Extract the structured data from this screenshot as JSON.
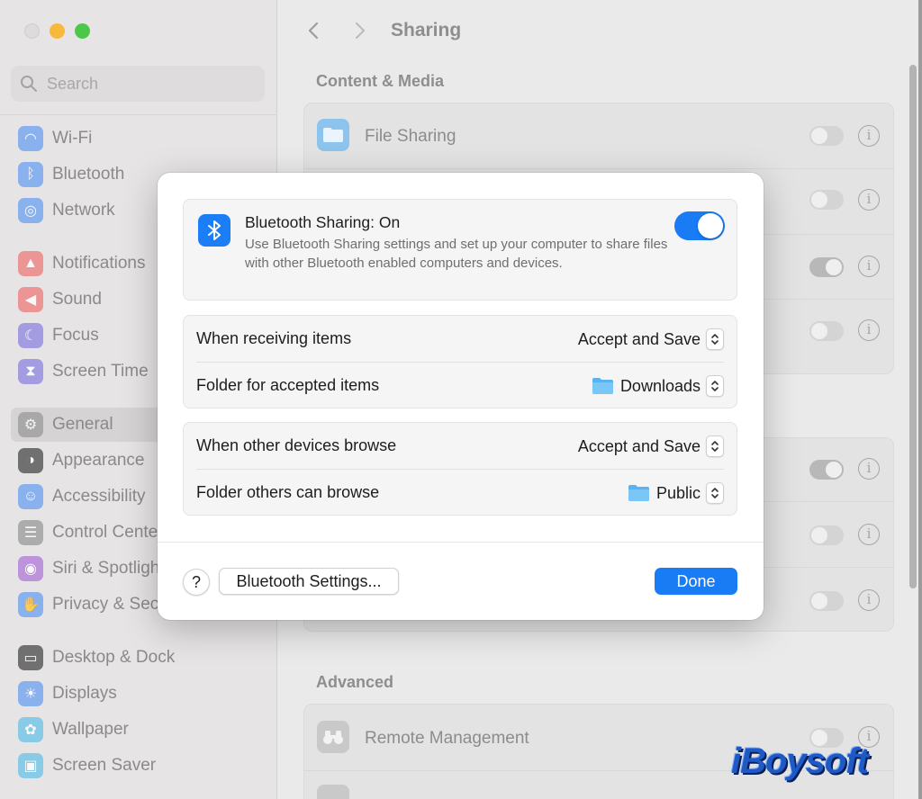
{
  "sidebar": {
    "search_placeholder": "Search",
    "items": [
      {
        "label": "Wi-Fi",
        "icon": "wifi-icon",
        "color": "#6aa0f2"
      },
      {
        "label": "Bluetooth",
        "icon": "bluetooth-icon",
        "color": "#6aa0f2"
      },
      {
        "label": "Network",
        "icon": "globe-icon",
        "color": "#6aa0f2"
      },
      {
        "label": "Notifications",
        "icon": "bell-icon",
        "color": "#ee7b7b"
      },
      {
        "label": "Sound",
        "icon": "speaker-icon",
        "color": "#ee7b7b"
      },
      {
        "label": "Focus",
        "icon": "moon-icon",
        "color": "#8f85e0"
      },
      {
        "label": "Screen Time",
        "icon": "hourglass-icon",
        "color": "#8f85e0"
      },
      {
        "label": "General",
        "icon": "gear-icon",
        "color": "#9a9a9a"
      },
      {
        "label": "Appearance",
        "icon": "appearance-icon",
        "color": "#4a4a4a"
      },
      {
        "label": "Accessibility",
        "icon": "accessibility-icon",
        "color": "#6aa0f2"
      },
      {
        "label": "Control Cente",
        "icon": "control-center-icon",
        "color": "#9a9a9a"
      },
      {
        "label": "Siri & Spotligh",
        "icon": "siri-icon",
        "color": "#b07ad8"
      },
      {
        "label": "Privacy & Sec",
        "icon": "hand-icon",
        "color": "#6aa0f2"
      },
      {
        "label": "Desktop & Dock",
        "icon": "dock-icon",
        "color": "#4a4a4a"
      },
      {
        "label": "Displays",
        "icon": "sun-icon",
        "color": "#6aa0f2"
      },
      {
        "label": "Wallpaper",
        "icon": "flower-icon",
        "color": "#6ac3e8"
      },
      {
        "label": "Screen Saver",
        "icon": "screensaver-icon",
        "color": "#6ac3e8"
      }
    ]
  },
  "main": {
    "title": "Sharing",
    "section_content_media": "Content & Media",
    "file_sharing_label": "File Sharing",
    "section_advanced": "Advanced",
    "remote_management_label": "Remote Management"
  },
  "modal": {
    "bt_title": "Bluetooth Sharing: On",
    "bt_description": "Use Bluetooth Sharing settings and set up your computer to share files with other Bluetooth enabled computers and devices.",
    "bt_enabled": true,
    "rows_group1": [
      {
        "label": "When receiving items",
        "value": "Accept and Save",
        "folder": false
      },
      {
        "label": "Folder for accepted items",
        "value": "Downloads",
        "folder": true
      }
    ],
    "rows_group2": [
      {
        "label": "When other devices browse",
        "value": "Accept and Save",
        "folder": false
      },
      {
        "label": "Folder others can browse",
        "value": "Public",
        "folder": true
      }
    ],
    "help_label": "?",
    "bt_settings_label": "Bluetooth Settings...",
    "done_label": "Done"
  },
  "watermark": "iBoysoft",
  "colors": {
    "accent": "#1a7cf5",
    "folder": "#5ab3f0"
  }
}
